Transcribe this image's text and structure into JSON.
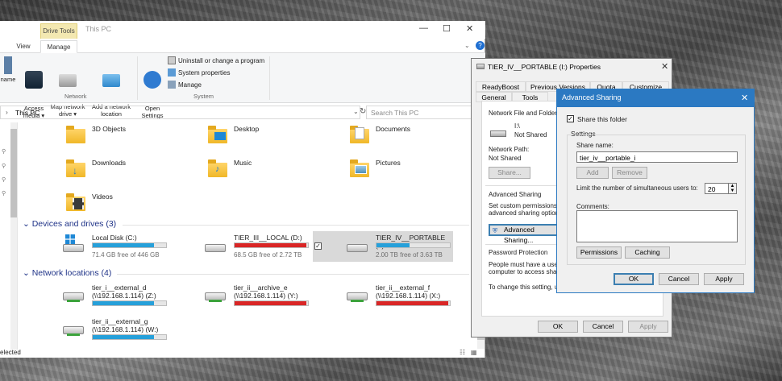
{
  "explorer": {
    "drive_tools_tab": "Drive Tools",
    "title": "This PC",
    "tabs": [
      "View",
      "Manage"
    ],
    "ribbon": {
      "network_group_label": "Network",
      "system_group_label": "System",
      "name_btn": "name",
      "access_media": "Access\nmedia ▾",
      "map_network_drive": "Map network\ndrive ▾",
      "add_network_location": "Add a network\nlocation",
      "open_settings": "Open\nSettings",
      "uninstall": "Uninstall or change a program",
      "system_properties": "System properties",
      "manage": "Manage"
    },
    "address": "This PC",
    "search_placeholder": "Search This PC",
    "folders": [
      "3D Objects",
      "Desktop",
      "Documents",
      "Downloads",
      "Music",
      "Pictures",
      "Videos"
    ],
    "devices_header": "Devices and drives (3)",
    "drives": [
      {
        "name": "Local Disk (C:)",
        "free": "71.4 GB free of 446 GB",
        "used_fraction": 0.84,
        "color": "#26a0da"
      },
      {
        "name": "TIER_III__LOCAL (D:)",
        "free": "68.5 GB free of 2.72 TB",
        "used_fraction": 0.98,
        "color": "#da2626"
      },
      {
        "name": "TIER_IV__PORTABLE (I:)",
        "free": "2.00 TB free of 3.63 TB",
        "used_fraction": 0.45,
        "color": "#26a0da"
      }
    ],
    "network_header": "Network locations (4)",
    "network": [
      {
        "name": "tier_i__external_d",
        "path": "(\\\\192.168.1.114) (Z:)",
        "used_fraction": 0.84,
        "color": "#26a0da"
      },
      {
        "name": "tier_ii__archive_e",
        "path": "(\\\\192.168.1.114) (Y:)",
        "used_fraction": 0.98,
        "color": "#da2626"
      },
      {
        "name": "tier_ii__external_f",
        "path": "(\\\\192.168.1.114) (X:)",
        "used_fraction": 0.98,
        "color": "#da2626"
      },
      {
        "name": "tier_ii__external_g",
        "path": "(\\\\192.168.1.114) (W:)",
        "used_fraction": 0.84,
        "color": "#26a0da"
      }
    ],
    "status": "elected"
  },
  "props": {
    "title": "TIER_IV__PORTABLE (I:) Properties",
    "tabs_row1": [
      "ReadyBoost",
      "Previous Versions",
      "Quota",
      "Customize"
    ],
    "tabs_row2": [
      "General",
      "Tools"
    ],
    "nffs": "Network File and Folder Sh",
    "path": "I:\\",
    "not_shared": "Not Shared",
    "network_path_label": "Network Path:",
    "network_path_value": "Not Shared",
    "share_btn": "Share...",
    "adv_header": "Advanced Sharing",
    "adv_desc1": "Set custom permissions, c",
    "adv_desc2": "advanced sharing options",
    "adv_btn": "Advanced Sharing...",
    "pw_header": "Password Protection",
    "pw_desc1": "People must have a user a",
    "pw_desc2": "computer to access shared",
    "pw_desc3": "To change this setting, use",
    "ok": "OK",
    "cancel": "Cancel",
    "apply": "Apply"
  },
  "adv": {
    "title": "Advanced Sharing",
    "share_this_folder": "Share this folder",
    "settings_label": "Settings",
    "share_name_label": "Share name:",
    "share_name_value": "tier_iv__portable_i",
    "add_btn": "Add",
    "remove_btn": "Remove",
    "limit_label": "Limit the number of simultaneous users to:",
    "limit_value": "20",
    "comments_label": "Comments:",
    "permissions_btn": "Permissions",
    "caching_btn": "Caching",
    "ok": "OK",
    "cancel": "Cancel",
    "apply": "Apply"
  }
}
